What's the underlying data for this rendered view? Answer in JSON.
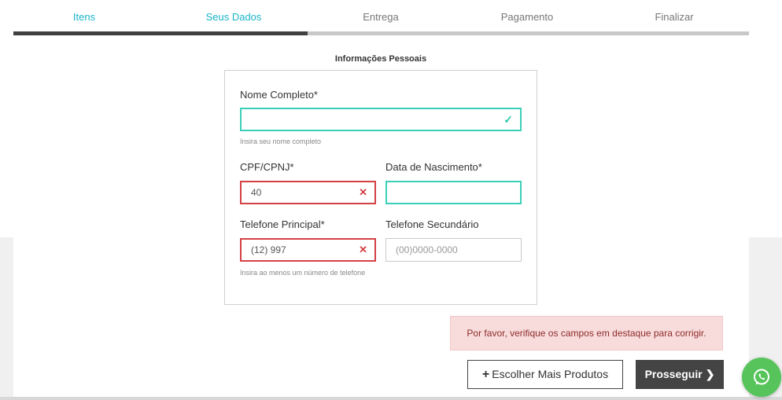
{
  "steps": [
    {
      "label": "Itens",
      "state": "done"
    },
    {
      "label": "Seus Dados",
      "state": "current"
    },
    {
      "label": "Entrega",
      "state": "pending"
    },
    {
      "label": "Pagamento",
      "state": "pending"
    },
    {
      "label": "Finalizar",
      "state": "pending"
    }
  ],
  "progress_fraction": 0.4,
  "section_title": "Informações Pessoais",
  "form": {
    "full_name": {
      "label": "Nome Completo*",
      "value": "",
      "hint": "Insira seu nome completo",
      "status": "valid",
      "status_icon": "check-icon"
    },
    "cpf": {
      "label": "CPF/CPNJ*",
      "value": "40",
      "status": "error",
      "status_icon": "cross-icon"
    },
    "birth_date": {
      "label": "Data de Nascimento*",
      "value": "",
      "status": "valid"
    },
    "phone_main": {
      "label": "Telefone Principal*",
      "value": "(12) 997",
      "status": "error",
      "status_icon": "cross-icon"
    },
    "phone_secondary": {
      "label": "Telefone Secundário",
      "value": "",
      "placeholder": "(00)0000-0000"
    },
    "phone_hint": "Insira ao menos um número de telefone"
  },
  "alert": {
    "text": "Por favor, verifique os campos em destaque para corrigir."
  },
  "buttons": {
    "more_products": "Escolher Mais Produtos",
    "more_icon": "plus-icon",
    "proceed": "Prosseguir",
    "proceed_icon": "chevron-right-icon"
  },
  "whatsapp": {
    "icon": "whatsapp-icon"
  },
  "colors": {
    "accent": "#1ab5c9",
    "valid": "#3ccfb7",
    "error": "#d54045",
    "dark": "#444444",
    "whatsapp": "#56c45a",
    "alert_bg": "#f8dcdc"
  }
}
